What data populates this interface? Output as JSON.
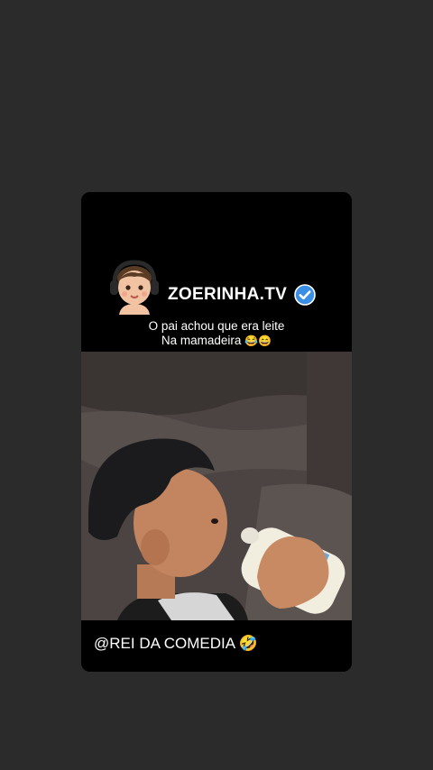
{
  "post": {
    "channel_name": "ZOERINHA.TV",
    "caption_line1": "O pai achou que era leite",
    "caption_line2": "Na mamadeira",
    "caption_emojis": "😂😄",
    "credit": "@REI DA COMEDIA 🤣"
  },
  "icons": {
    "avatar": "baby-with-headphones-icon",
    "verified": "verified-badge-icon"
  },
  "colors": {
    "background": "#2b2b2b",
    "card": "#000000",
    "verified_badge": "#3a8ee6"
  }
}
